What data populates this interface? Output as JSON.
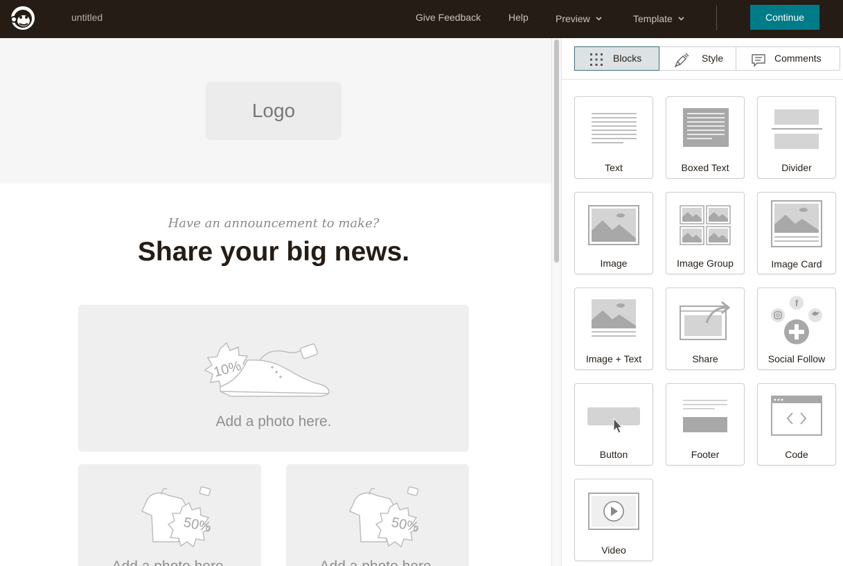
{
  "topbar": {
    "doc_title": "untitled",
    "nav": {
      "feedback": "Give Feedback",
      "help": "Help",
      "preview": "Preview",
      "template": "Template"
    },
    "continue_label": "Continue",
    "brand_color": "#007c89"
  },
  "canvas": {
    "logo_placeholder": "Logo",
    "subtitle": "Have an announcement to make?",
    "headline": "Share your big news.",
    "photo_big": {
      "badge": "10%",
      "text": "Add a photo here."
    },
    "photo_small": [
      {
        "badge": "50%",
        "text": "Add a photo here."
      },
      {
        "badge": "50%",
        "text": "Add a photo here."
      }
    ]
  },
  "panel": {
    "tabs": [
      {
        "label": "Blocks",
        "icon": "grid-icon",
        "active": true
      },
      {
        "label": "Style",
        "icon": "paint-brush-icon",
        "active": false
      },
      {
        "label": "Comments",
        "icon": "comment-icon",
        "active": false
      }
    ],
    "blocks": [
      {
        "label": "Text",
        "icon": "text-block-icon"
      },
      {
        "label": "Boxed Text",
        "icon": "boxed-text-block-icon"
      },
      {
        "label": "Divider",
        "icon": "divider-block-icon"
      },
      {
        "label": "Image",
        "icon": "image-block-icon"
      },
      {
        "label": "Image Group",
        "icon": "image-group-block-icon"
      },
      {
        "label": "Image Card",
        "icon": "image-card-block-icon"
      },
      {
        "label": "Image + Text",
        "icon": "image-text-block-icon"
      },
      {
        "label": "Share",
        "icon": "share-block-icon"
      },
      {
        "label": "Social Follow",
        "icon": "social-follow-block-icon"
      },
      {
        "label": "Button",
        "icon": "button-block-icon"
      },
      {
        "label": "Footer",
        "icon": "footer-block-icon"
      },
      {
        "label": "Code",
        "icon": "code-block-icon"
      },
      {
        "label": "Video",
        "icon": "video-block-icon"
      }
    ]
  }
}
